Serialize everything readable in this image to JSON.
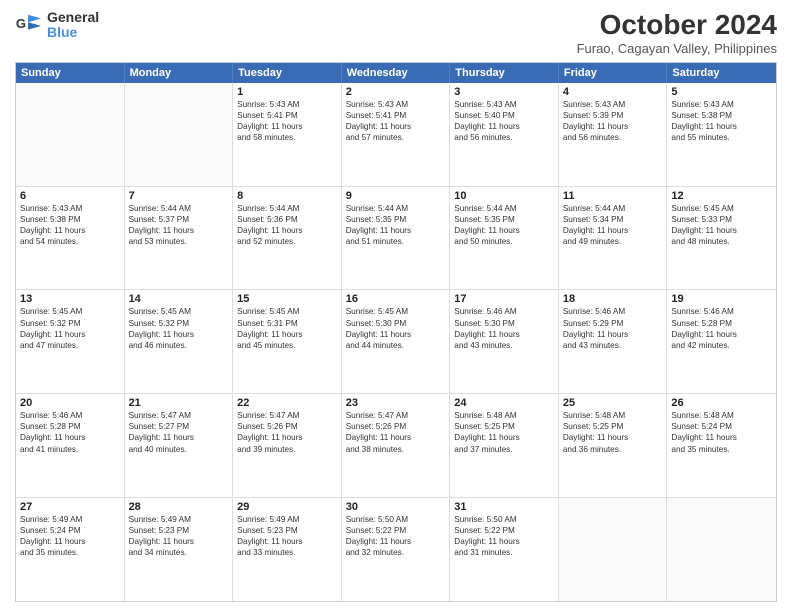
{
  "logo": {
    "line1": "General",
    "line2": "Blue"
  },
  "title": "October 2024",
  "location": "Furao, Cagayan Valley, Philippines",
  "days_header": [
    "Sunday",
    "Monday",
    "Tuesday",
    "Wednesday",
    "Thursday",
    "Friday",
    "Saturday"
  ],
  "weeks": [
    [
      {
        "day": "",
        "empty": true
      },
      {
        "day": "",
        "empty": true
      },
      {
        "day": "1",
        "line1": "Sunrise: 5:43 AM",
        "line2": "Sunset: 5:41 PM",
        "line3": "Daylight: 11 hours",
        "line4": "and 58 minutes."
      },
      {
        "day": "2",
        "line1": "Sunrise: 5:43 AM",
        "line2": "Sunset: 5:41 PM",
        "line3": "Daylight: 11 hours",
        "line4": "and 57 minutes."
      },
      {
        "day": "3",
        "line1": "Sunrise: 5:43 AM",
        "line2": "Sunset: 5:40 PM",
        "line3": "Daylight: 11 hours",
        "line4": "and 56 minutes."
      },
      {
        "day": "4",
        "line1": "Sunrise: 5:43 AM",
        "line2": "Sunset: 5:39 PM",
        "line3": "Daylight: 11 hours",
        "line4": "and 56 minutes."
      },
      {
        "day": "5",
        "line1": "Sunrise: 5:43 AM",
        "line2": "Sunset: 5:38 PM",
        "line3": "Daylight: 11 hours",
        "line4": "and 55 minutes."
      }
    ],
    [
      {
        "day": "6",
        "line1": "Sunrise: 5:43 AM",
        "line2": "Sunset: 5:38 PM",
        "line3": "Daylight: 11 hours",
        "line4": "and 54 minutes."
      },
      {
        "day": "7",
        "line1": "Sunrise: 5:44 AM",
        "line2": "Sunset: 5:37 PM",
        "line3": "Daylight: 11 hours",
        "line4": "and 53 minutes."
      },
      {
        "day": "8",
        "line1": "Sunrise: 5:44 AM",
        "line2": "Sunset: 5:36 PM",
        "line3": "Daylight: 11 hours",
        "line4": "and 52 minutes."
      },
      {
        "day": "9",
        "line1": "Sunrise: 5:44 AM",
        "line2": "Sunset: 5:35 PM",
        "line3": "Daylight: 11 hours",
        "line4": "and 51 minutes."
      },
      {
        "day": "10",
        "line1": "Sunrise: 5:44 AM",
        "line2": "Sunset: 5:35 PM",
        "line3": "Daylight: 11 hours",
        "line4": "and 50 minutes."
      },
      {
        "day": "11",
        "line1": "Sunrise: 5:44 AM",
        "line2": "Sunset: 5:34 PM",
        "line3": "Daylight: 11 hours",
        "line4": "and 49 minutes."
      },
      {
        "day": "12",
        "line1": "Sunrise: 5:45 AM",
        "line2": "Sunset: 5:33 PM",
        "line3": "Daylight: 11 hours",
        "line4": "and 48 minutes."
      }
    ],
    [
      {
        "day": "13",
        "line1": "Sunrise: 5:45 AM",
        "line2": "Sunset: 5:32 PM",
        "line3": "Daylight: 11 hours",
        "line4": "and 47 minutes."
      },
      {
        "day": "14",
        "line1": "Sunrise: 5:45 AM",
        "line2": "Sunset: 5:32 PM",
        "line3": "Daylight: 11 hours",
        "line4": "and 46 minutes."
      },
      {
        "day": "15",
        "line1": "Sunrise: 5:45 AM",
        "line2": "Sunset: 5:31 PM",
        "line3": "Daylight: 11 hours",
        "line4": "and 45 minutes."
      },
      {
        "day": "16",
        "line1": "Sunrise: 5:45 AM",
        "line2": "Sunset: 5:30 PM",
        "line3": "Daylight: 11 hours",
        "line4": "and 44 minutes."
      },
      {
        "day": "17",
        "line1": "Sunrise: 5:46 AM",
        "line2": "Sunset: 5:30 PM",
        "line3": "Daylight: 11 hours",
        "line4": "and 43 minutes."
      },
      {
        "day": "18",
        "line1": "Sunrise: 5:46 AM",
        "line2": "Sunset: 5:29 PM",
        "line3": "Daylight: 11 hours",
        "line4": "and 43 minutes."
      },
      {
        "day": "19",
        "line1": "Sunrise: 5:46 AM",
        "line2": "Sunset: 5:28 PM",
        "line3": "Daylight: 11 hours",
        "line4": "and 42 minutes."
      }
    ],
    [
      {
        "day": "20",
        "line1": "Sunrise: 5:46 AM",
        "line2": "Sunset: 5:28 PM",
        "line3": "Daylight: 11 hours",
        "line4": "and 41 minutes."
      },
      {
        "day": "21",
        "line1": "Sunrise: 5:47 AM",
        "line2": "Sunset: 5:27 PM",
        "line3": "Daylight: 11 hours",
        "line4": "and 40 minutes."
      },
      {
        "day": "22",
        "line1": "Sunrise: 5:47 AM",
        "line2": "Sunset: 5:26 PM",
        "line3": "Daylight: 11 hours",
        "line4": "and 39 minutes."
      },
      {
        "day": "23",
        "line1": "Sunrise: 5:47 AM",
        "line2": "Sunset: 5:26 PM",
        "line3": "Daylight: 11 hours",
        "line4": "and 38 minutes."
      },
      {
        "day": "24",
        "line1": "Sunrise: 5:48 AM",
        "line2": "Sunset: 5:25 PM",
        "line3": "Daylight: 11 hours",
        "line4": "and 37 minutes."
      },
      {
        "day": "25",
        "line1": "Sunrise: 5:48 AM",
        "line2": "Sunset: 5:25 PM",
        "line3": "Daylight: 11 hours",
        "line4": "and 36 minutes."
      },
      {
        "day": "26",
        "line1": "Sunrise: 5:48 AM",
        "line2": "Sunset: 5:24 PM",
        "line3": "Daylight: 11 hours",
        "line4": "and 35 minutes."
      }
    ],
    [
      {
        "day": "27",
        "line1": "Sunrise: 5:49 AM",
        "line2": "Sunset: 5:24 PM",
        "line3": "Daylight: 11 hours",
        "line4": "and 35 minutes."
      },
      {
        "day": "28",
        "line1": "Sunrise: 5:49 AM",
        "line2": "Sunset: 5:23 PM",
        "line3": "Daylight: 11 hours",
        "line4": "and 34 minutes."
      },
      {
        "day": "29",
        "line1": "Sunrise: 5:49 AM",
        "line2": "Sunset: 5:23 PM",
        "line3": "Daylight: 11 hours",
        "line4": "and 33 minutes."
      },
      {
        "day": "30",
        "line1": "Sunrise: 5:50 AM",
        "line2": "Sunset: 5:22 PM",
        "line3": "Daylight: 11 hours",
        "line4": "and 32 minutes."
      },
      {
        "day": "31",
        "line1": "Sunrise: 5:50 AM",
        "line2": "Sunset: 5:22 PM",
        "line3": "Daylight: 11 hours",
        "line4": "and 31 minutes."
      },
      {
        "day": "",
        "empty": true
      },
      {
        "day": "",
        "empty": true
      }
    ]
  ]
}
